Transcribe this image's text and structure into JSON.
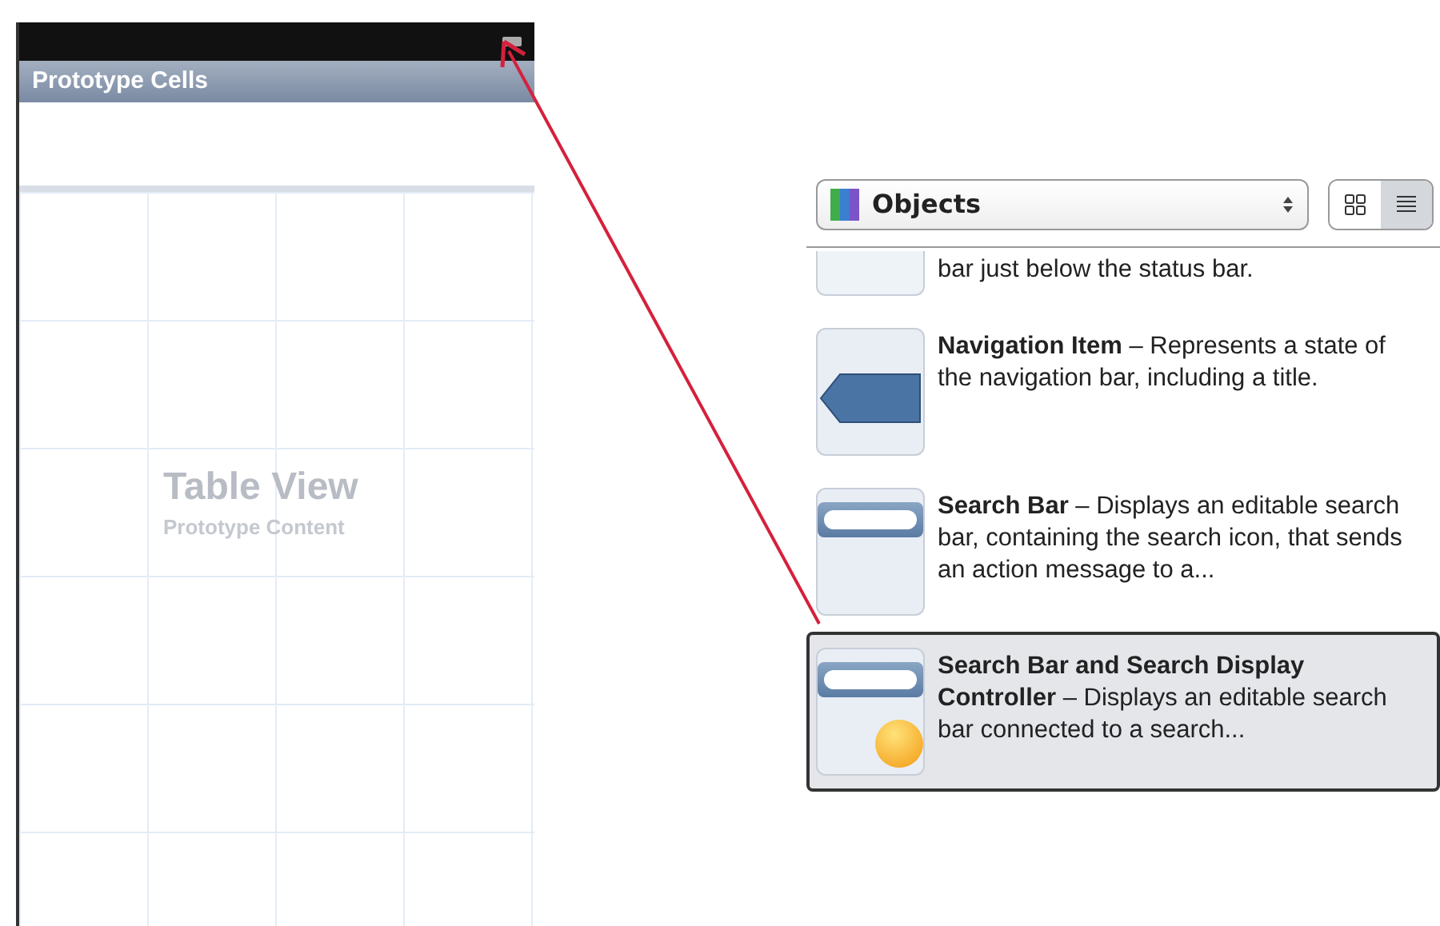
{
  "canvas": {
    "section_header": "Prototype Cells",
    "table_title": "Table View",
    "table_subtitle": "Prototype Content"
  },
  "library": {
    "selector": {
      "label": "Objects"
    },
    "view_modes": [
      {
        "kind": "grid",
        "selected": false
      },
      {
        "kind": "list",
        "selected": true
      }
    ],
    "items": [
      {
        "kind": "bar",
        "text": "bar just below the status bar.",
        "selected": false
      },
      {
        "kind": "navigation-item",
        "text": "**Navigation Item** – Represents a state of the navigation bar, including a title.",
        "selected": false
      },
      {
        "kind": "search-bar",
        "text": "**Search Bar** – Displays an editable search bar, containing the search icon, that sends an action message to a...",
        "selected": false
      },
      {
        "kind": "search-display",
        "text": "**Search Bar and Search Display Controller** – Displays an editable search bar connected to a search...",
        "selected": true
      }
    ]
  }
}
